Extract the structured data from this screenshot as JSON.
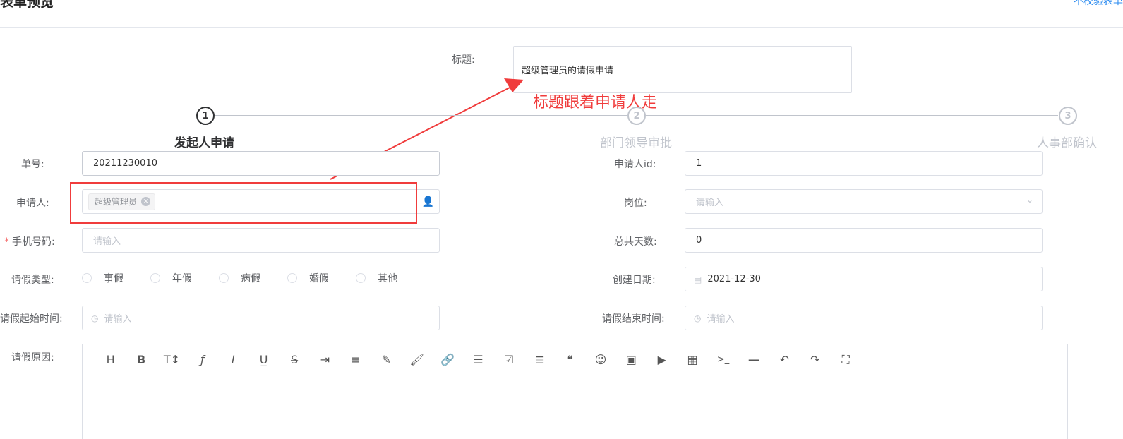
{
  "header": {
    "title": "表单预览",
    "link": "不校验表单"
  },
  "title_field": {
    "label": "标题:",
    "value": "超级管理员的请假申请"
  },
  "annotation": {
    "text": "标题跟着申请人走"
  },
  "steps": [
    {
      "number": "1",
      "label": "发起人申请",
      "active": true
    },
    {
      "number": "2",
      "label": "部门领导审批",
      "active": false
    },
    {
      "number": "3",
      "label": "人事部确认",
      "active": false
    }
  ],
  "form": {
    "order_no": {
      "label": "单号:",
      "value": "20211230010"
    },
    "applicant_id": {
      "label": "申请人id:",
      "value": "1"
    },
    "applicant": {
      "label": "申请人:",
      "tag": "超级管理员"
    },
    "position": {
      "label": "岗位:",
      "placeholder": "请输入"
    },
    "phone": {
      "label": "手机号码:",
      "required_mark": "*",
      "placeholder": "请输入"
    },
    "total_days": {
      "label": "总共天数:",
      "value": "0"
    },
    "leave_type": {
      "label": "请假类型:",
      "options": [
        "事假",
        "年假",
        "病假",
        "婚假",
        "其他"
      ]
    },
    "create_date": {
      "label": "创建日期:",
      "value": "2021-12-30"
    },
    "start_time": {
      "label": "请假起始时间:",
      "placeholder": "请输入"
    },
    "end_time": {
      "label": "请假结束时间:",
      "placeholder": "请输入"
    },
    "reason": {
      "label": "请假原因:"
    }
  },
  "editor_toolbar": [
    {
      "icon": "heading-icon",
      "glyph": "H"
    },
    {
      "icon": "bold-icon",
      "glyph": "B"
    },
    {
      "icon": "font-size-icon",
      "glyph": "T↕"
    },
    {
      "icon": "font-family-icon",
      "glyph": "ƒ"
    },
    {
      "icon": "italic-icon",
      "glyph": "I"
    },
    {
      "icon": "underline-icon",
      "glyph": "U̲"
    },
    {
      "icon": "strikethrough-icon",
      "glyph": "S̶"
    },
    {
      "icon": "indent-icon",
      "glyph": "⇥"
    },
    {
      "icon": "line-height-icon",
      "glyph": "≡"
    },
    {
      "icon": "font-color-icon",
      "glyph": "✎"
    },
    {
      "icon": "background-color-icon",
      "glyph": "🖌"
    },
    {
      "icon": "link-icon",
      "glyph": "🔗"
    },
    {
      "icon": "list-icon",
      "glyph": "☰"
    },
    {
      "icon": "todo-icon",
      "glyph": "☑"
    },
    {
      "icon": "justify-icon",
      "glyph": "≣"
    },
    {
      "icon": "quote-icon",
      "glyph": "❝"
    },
    {
      "icon": "emoticon-icon",
      "glyph": "☺"
    },
    {
      "icon": "image-icon",
      "glyph": "▣"
    },
    {
      "icon": "video-icon",
      "glyph": "▶"
    },
    {
      "icon": "table-icon",
      "glyph": "▦"
    },
    {
      "icon": "code-icon",
      "glyph": ">_"
    },
    {
      "icon": "divider-icon",
      "glyph": "—"
    },
    {
      "icon": "undo-icon",
      "glyph": "↶"
    },
    {
      "icon": "redo-icon",
      "glyph": "↷"
    },
    {
      "icon": "fullscreen-icon",
      "glyph": "⛶"
    }
  ],
  "colors": {
    "annotation": "#f03c3c",
    "link": "#2d8cf0",
    "border": "#dcdfe6",
    "placeholder": "#c0c4cc"
  }
}
